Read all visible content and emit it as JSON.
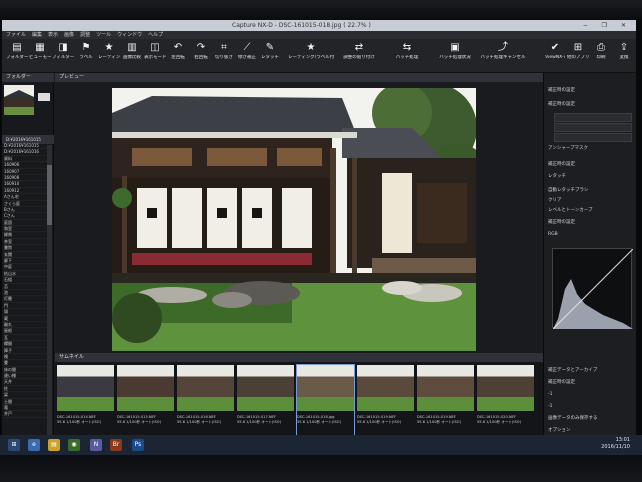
{
  "window": {
    "title": "Capture NX-D  -  DSC-161015-018.jpg ( 22.7% )",
    "controls": "− ❐ ✕"
  },
  "menu": [
    "ファイル",
    "編集",
    "表示",
    "画像",
    "調整",
    "ツール",
    "ウィンドウ",
    "ヘルプ"
  ],
  "toolbar": {
    "items": [
      {
        "icon": "folder-icon",
        "glyph": "▤",
        "label": "フォルダー"
      },
      {
        "icon": "grid-icon",
        "glyph": "▦",
        "label": "ビューモード"
      },
      {
        "icon": "filter-icon",
        "glyph": "◨",
        "label": "フィルター"
      },
      {
        "icon": "label-icon",
        "glyph": "⚑",
        "label": "ラベル"
      },
      {
        "icon": "rating-icon",
        "glyph": "★",
        "label": "レーティング"
      },
      {
        "icon": "compare-icon",
        "glyph": "▥",
        "label": "画像比較"
      },
      {
        "icon": "view-icon",
        "glyph": "◫",
        "label": "表示モード"
      },
      {
        "icon": "rotate-left-icon",
        "glyph": "↶",
        "label": "左回転"
      },
      {
        "icon": "rotate-right-icon",
        "glyph": "↷",
        "label": "右回転"
      },
      {
        "icon": "crop-icon",
        "glyph": "⌗",
        "label": "切り抜き"
      },
      {
        "icon": "straighten-icon",
        "glyph": "⟋",
        "label": "傾き補正"
      },
      {
        "icon": "pen-icon",
        "glyph": "✎",
        "label": "レタッチ"
      }
    ],
    "wide_items": [
      {
        "icon": "star-icon",
        "glyph": "★",
        "label": "レーティング/ラベル付け"
      },
      {
        "icon": "adjust-icon",
        "glyph": "⇄",
        "label": "調整の貼り付け"
      },
      {
        "icon": "batch-icon",
        "glyph": "⇆",
        "label": "バッチ処理"
      },
      {
        "icon": "monitor-icon",
        "glyph": "▣",
        "label": "バッチ処理状況"
      },
      {
        "icon": "cancel-icon",
        "glyph": "⤴",
        "label": "バッチ処理キャンセル"
      }
    ],
    "right_items": [
      {
        "icon": "viewnx-icon",
        "glyph": "✔",
        "label": "ViewNX-i"
      },
      {
        "icon": "app-icon",
        "glyph": "⊞",
        "label": "他のアプリ"
      },
      {
        "icon": "print-icon",
        "glyph": "⎙",
        "label": "印刷"
      },
      {
        "icon": "convert-icon",
        "glyph": "⇪",
        "label": "変換"
      }
    ]
  },
  "left_panel": {
    "header": "フォルダー",
    "folders": [
      "D:¥2016¥161015",
      "D:¥2016¥161016",
      "資料",
      "160906",
      "160907",
      "160908",
      "160910",
      "160912",
      "Aさん宅",
      "さくら庭",
      "Bさん",
      "Cさん",
      "庭園",
      "和室",
      "縁側",
      "茶室",
      "書院",
      "玄関",
      "廊下",
      "中庭",
      "枯山水",
      "石組",
      "苔",
      "池",
      "灯籠",
      "門",
      "塀",
      "蔵",
      "離れ",
      "屋根",
      "瓦",
      "欄間",
      "障子",
      "襖",
      "畳",
      "床の間",
      "違い棚",
      "天井",
      "柱",
      "梁",
      "土間",
      "竈",
      "井戸"
    ]
  },
  "viewer": {
    "header": "プレビュー"
  },
  "filmstrip": {
    "header": "サムネイル",
    "frames": [
      {
        "name": "DSC-161015-014.NEF",
        "meta": "55.6 1/100秒 オート(ISO)"
      },
      {
        "name": "DSC-161015-015.NEF",
        "meta": "55.6 1/100秒 オート(ISO)"
      },
      {
        "name": "DSC-161015-016.NEF",
        "meta": "55.6 1/100秒 オート(ISO)"
      },
      {
        "name": "DSC-161015-017.NEF",
        "meta": "55.6 1/100秒 オート(ISO)"
      },
      {
        "name": "DSC-161015-018.jpg",
        "meta": "55.6 1/100秒 オート(ISO)"
      },
      {
        "name": "DSC-161015-019.NEF",
        "meta": "55.6 1/100秒 オート(ISO)"
      },
      {
        "name": "DSC-161015-019.NEF",
        "meta": "55.6 1/100秒 オート(ISO)"
      },
      {
        "name": "DSC-161015-020.NEF",
        "meta": "55.6 1/100秒 オート(ISO)"
      }
    ]
  },
  "right_panel": {
    "rows": [
      "補正時の設定",
      "補正時の設定",
      "アンシャープマスク",
      "補正時の設定",
      "レタッチ",
      "自動レタッチブラシ",
      "クリア",
      "レベルとトーンカーブ",
      "補正時の設定",
      "RGB",
      "RGB",
      "補正データとアーカイブ",
      "補正時の設定",
      "-1",
      "-1",
      "画像データのみ保存する",
      "オプション",
      "-1",
      "-1"
    ]
  },
  "status": {
    "left": "",
    "mid": "22.7%   Adobe RGB (1998)",
    "right": "4928x3264     29/30"
  },
  "taskbar": {
    "clock_time": "13:01",
    "clock_date": "2016/11/10"
  },
  "colors": {
    "accent": "#7a9ad6",
    "sky": "#f4f4f0",
    "grass": "#5d8f3a"
  }
}
